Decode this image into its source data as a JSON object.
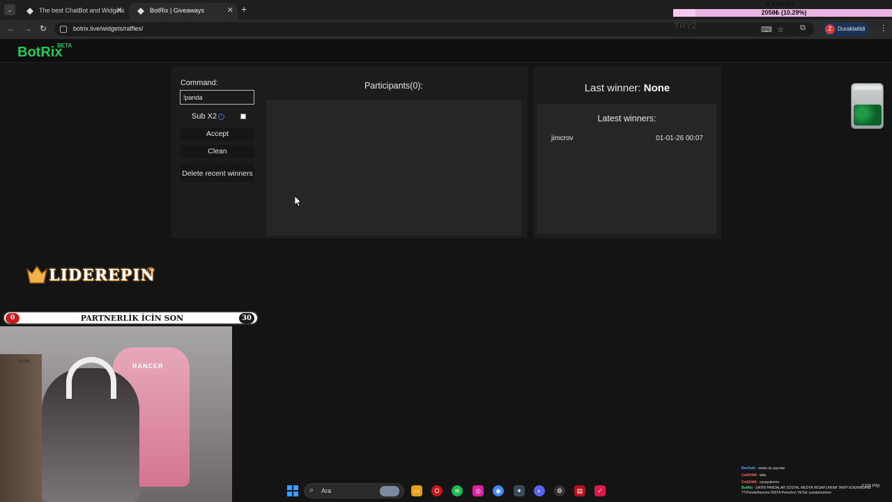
{
  "browser": {
    "tabs": [
      {
        "title": "The best ChatBot and Widgets"
      },
      {
        "title": "BotRix | Giveaways"
      }
    ],
    "url": "botrix.live/widgets/raffles/",
    "profile_initial": "Z",
    "profile_name": "Duraklatildi"
  },
  "stream_overlay": {
    "camera_label": "KAMERA",
    "goal_text": "2058₺ (10.29%)",
    "goal_fraction": 0.1029,
    "try_left": "TRY2",
    "try_right": "TRY20000"
  },
  "site": {
    "logo": "BotRix",
    "beta": "BETA"
  },
  "raffle": {
    "command_label": "Command:",
    "command_value": "!panda",
    "sub_label": "Sub X2",
    "sub_checked": false,
    "accept_label": "Accept",
    "clean_label": "Clean",
    "delete_label": "Delete recent winners",
    "participants_title": "Participants(0):"
  },
  "winners": {
    "last_winner_prefix": "Last winner:",
    "last_winner_name": "None",
    "latest_title": "Latest winners:",
    "rows": [
      {
        "name": "jimcrov",
        "date": "01-01-26 00:07"
      }
    ]
  },
  "overlay_bottom": {
    "brand": "LIDEREPIN",
    "partner_left": "0",
    "partner_text": "PARTNERLİK İCİN SON",
    "partner_right": "30",
    "chair_brand": "RANCER",
    "cam_label": "NUUK"
  },
  "taskbar": {
    "search_placeholder": "Ara",
    "clock": "7:03 PM"
  },
  "chat": [
    {
      "user": "DevTurk",
      "msg": "selam iyi yayınlar"
    },
    {
      "user": "Celil2444",
      "msg": "abla"
    },
    {
      "user": "Celil2444",
      "msg": "oynayalımmı"
    },
    {
      "user": "BotRix",
      "msg": "SAYIN PANDALAR SOSYAL MEDYA HESAPLARIMI TAKİP EDERMİSİNİZ YT:PandaHanımm INSTA:Pemzhnn TikTok: pandahanimm"
    }
  ],
  "colors": {
    "brand_green": "#28c95a",
    "panel_bg": "#1c1c1c",
    "box_bg": "#262626",
    "page_bg": "#141414"
  }
}
